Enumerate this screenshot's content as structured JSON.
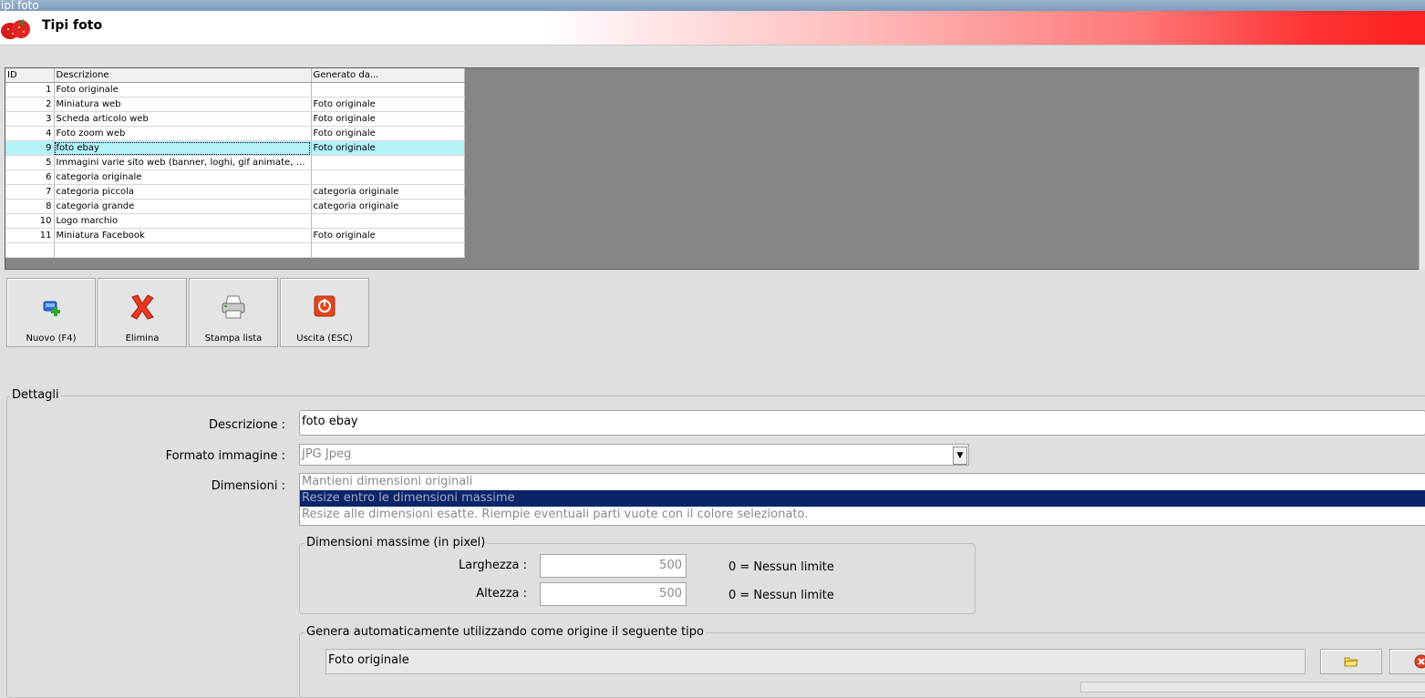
{
  "window": {
    "title": "ipi foto"
  },
  "header": {
    "title": "Tipi foto"
  },
  "grid": {
    "columns": [
      "ID",
      "Descrizione",
      "Generato da..."
    ],
    "rows": [
      {
        "id": "1",
        "descrizione": "Foto originale",
        "generato": ""
      },
      {
        "id": "2",
        "descrizione": "Miniatura web",
        "generato": "Foto originale"
      },
      {
        "id": "3",
        "descrizione": "Scheda articolo web",
        "generato": "Foto originale"
      },
      {
        "id": "4",
        "descrizione": "Foto zoom web",
        "generato": "Foto originale"
      },
      {
        "id": "9",
        "descrizione": "foto ebay",
        "generato": "Foto originale"
      },
      {
        "id": "5",
        "descrizione": "Immagini varie sito web (banner, loghi, gif animate, fla...",
        "generato": ""
      },
      {
        "id": "6",
        "descrizione": "categoria originale",
        "generato": ""
      },
      {
        "id": "7",
        "descrizione": "categoria piccola",
        "generato": "categoria originale"
      },
      {
        "id": "8",
        "descrizione": "categoria grande",
        "generato": "categoria originale"
      },
      {
        "id": "10",
        "descrizione": "Logo marchio",
        "generato": ""
      },
      {
        "id": "11",
        "descrizione": "Miniatura Facebook",
        "generato": "Foto originale"
      },
      {
        "id": "",
        "descrizione": "",
        "generato": ""
      }
    ],
    "selected_row_id": "9",
    "selection_color": "#b3f2f7"
  },
  "toolbar": {
    "new_label": "Nuovo (F4)",
    "delete_label": "Elimina",
    "print_label": "Stampa lista",
    "exit_label": "Uscita (ESC)"
  },
  "details": {
    "legend": "Dettagli",
    "descrizione_label": "Descrizione :",
    "descrizione_value": "foto ebay",
    "formato_label": "Formato immagine :",
    "formato_value": "JPG Jpeg",
    "dimensioni_label": "Dimensioni :",
    "dimensioni_options": [
      "Mantieni dimensioni originali",
      "Resize entro le dimensioni massime",
      "Resize alle dimensioni esatte. Riempie eventuali parti vuote con il colore selezionato."
    ],
    "dimensioni_selected_index": 1,
    "max_group": {
      "legend": "Dimensioni massime (in pixel)",
      "larghezza_label": "Larghezza :",
      "larghezza_value": "500",
      "altezza_label": "Altezza :",
      "altezza_value": "500",
      "larghezza_hint": "0 =  Nessun limite",
      "altezza_hint": "0 =  Nessun limite"
    },
    "origin_group": {
      "legend": "Genera automaticamente utilizzando come origine il seguente tipo",
      "value": "Foto originale"
    }
  },
  "colors": {
    "accent_red": "#ff1f1f",
    "list_selected": "#0a246a"
  }
}
